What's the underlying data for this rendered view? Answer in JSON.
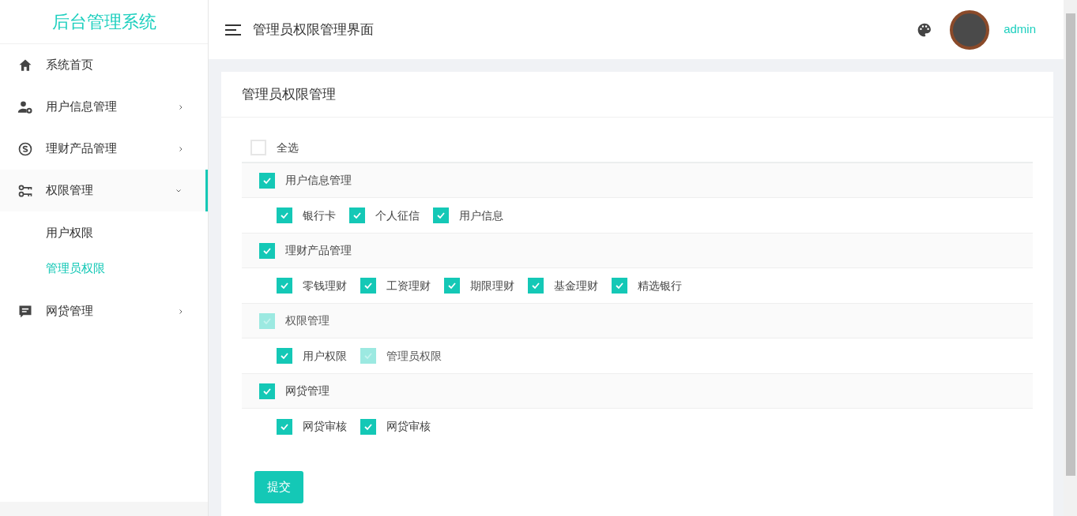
{
  "sidebar": {
    "logo": "后台管理系统",
    "items": [
      {
        "label": "系统首页",
        "kind": "link",
        "selected": false
      },
      {
        "label": "用户信息管理",
        "kind": "submenu",
        "expanded": false,
        "selected": false
      },
      {
        "label": "理财产品管理",
        "kind": "submenu",
        "expanded": false,
        "selected": false
      },
      {
        "label": "权限管理",
        "kind": "submenu",
        "expanded": true,
        "selected": true,
        "children": [
          {
            "label": "用户权限",
            "selected": false
          },
          {
            "label": "管理员权限",
            "selected": true
          }
        ]
      },
      {
        "label": "网贷管理",
        "kind": "submenu",
        "expanded": false,
        "selected": false
      }
    ]
  },
  "header": {
    "title": "管理员权限管理界面",
    "user": "admin"
  },
  "card": {
    "title": "管理员权限管理",
    "select_all": {
      "label": "全选",
      "checked": false
    },
    "groups": [
      {
        "label": "用户信息管理",
        "checked": true,
        "disabled": false,
        "children": [
          {
            "label": "银行卡",
            "checked": true,
            "disabled": false
          },
          {
            "label": "个人征信",
            "checked": true,
            "disabled": false
          },
          {
            "label": "用户信息",
            "checked": true,
            "disabled": false
          }
        ]
      },
      {
        "label": "理财产品管理",
        "checked": true,
        "disabled": false,
        "children": [
          {
            "label": "零钱理财",
            "checked": true,
            "disabled": false
          },
          {
            "label": "工资理财",
            "checked": true,
            "disabled": false
          },
          {
            "label": "期限理财",
            "checked": true,
            "disabled": false
          },
          {
            "label": "基金理财",
            "checked": true,
            "disabled": false
          },
          {
            "label": "精选银行",
            "checked": true,
            "disabled": false
          }
        ]
      },
      {
        "label": "权限管理",
        "checked": true,
        "disabled": true,
        "children": [
          {
            "label": "用户权限",
            "checked": true,
            "disabled": false
          },
          {
            "label": "管理员权限",
            "checked": true,
            "disabled": true
          }
        ]
      },
      {
        "label": "网贷管理",
        "checked": true,
        "disabled": false,
        "children": [
          {
            "label": "网贷审核",
            "checked": true,
            "disabled": false
          },
          {
            "label": "网贷审核",
            "checked": true,
            "disabled": false
          }
        ]
      }
    ],
    "submit": "提交"
  }
}
